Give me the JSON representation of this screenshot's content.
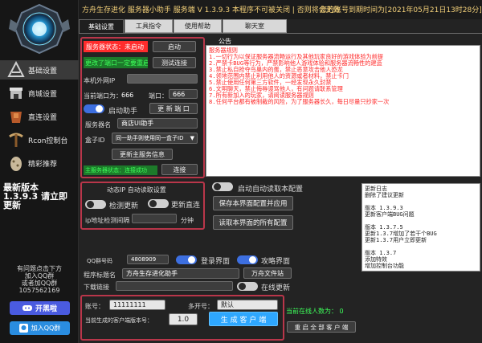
{
  "header": {
    "title": "方舟生存进化  服务器小助手  服务端 V 1.3.9.3 本程序不可被关闭 | 否则将会无效",
    "account": "您的账号到期时间为[2021年05月21日13时28分]"
  },
  "sidebar": {
    "items": [
      {
        "label": "基础设置",
        "icon": "ark-logo-icon"
      },
      {
        "label": "商城设置",
        "icon": "shop-icon"
      },
      {
        "label": "直连设置",
        "icon": "armor-icon"
      },
      {
        "label": "Rcon控制台",
        "icon": "pickaxe-icon"
      },
      {
        "label": "精彩推荐",
        "icon": "dino-egg-icon"
      }
    ],
    "promo": "最新版本\n1.3.9.3 请立即\n更新",
    "contact": "有问题点击下方\n加入QQ群\n或者加QQ群\n1057562169",
    "dark_btn": "开黑啦",
    "qq_btn": "加入QQ群"
  },
  "tabs": [
    "基础设置",
    "工具指令",
    "使用帮助",
    "聊天室"
  ],
  "left_panel": {
    "status_label": "服务器状态：未启动",
    "start_btn": "启动",
    "port_warning": "更改了端口一定要重启",
    "test_btn": "测试连接",
    "ip_label": "本机外网IP",
    "ip_value": "",
    "port_label": "当前端口为：",
    "port_value": "666",
    "port2_label": "端口：",
    "port2_value": "666",
    "auto_start_label": "启动助手",
    "update_port_btn": "更 新 端 口",
    "server_name_label": "服务器名",
    "server_name_value": "商店UI助手",
    "box_id_label": "盒子ID",
    "box_id_value": "同一助手则使用同一盒子ID",
    "update_server_btn": "更新主服务信息",
    "main_status": "主服务器状态：连接成功",
    "connect_btn": "连接"
  },
  "announcement": {
    "title": "公告",
    "text": "服务器规则\n1.一切行为以保证服务器流畅运行及其他玩家良好的游戏体验为前提\n2.严禁卡BUG等行为，严禁影响他人游戏体验和服务器流畅性的建造\n3.禁止私自抢夺鸟巢内的蛋，禁止恶意攻击他人恐龙\n4.领地范围内禁止利用他人的资源或者材料，禁止卡门\n5.禁止使用任何第三方软件，一经发现永久封禁\n6.文明聊天，禁止侮辱谩骂他人，有问题请联系管理\n7.所有新加入的玩家，请阅读服务器规则\n8.任何平台都有被制裁的风险，为了服务器长久，每日尽量只抄家一次"
  },
  "auto_read": {
    "label": "启动自动读取本配置"
  },
  "dynamic_ip": {
    "title": "动态IP 自动读取设置",
    "detect_label": "检测更新",
    "direct_label": "更新直连",
    "interval_label": "ip地址检测间隔",
    "interval_value": "",
    "unit": "分钟"
  },
  "config_btns": {
    "save": "保存本界面配置并应用",
    "load": "读取本界面的所有配置"
  },
  "changelog": "更新日志\n删除了建议更新\n\n版本 1.3.9.3\n更新客户端BUG问题\n\n版本 1.3.7.5\n更新1.3.7增加了若干个BUG\n更新1.3.7用户立即更新\n\n版本 1.3.7\n添加特效\n增加控制台功能",
  "bottom": {
    "qq_label": "QQ群号码",
    "qq_value": "4808909",
    "login_label": "登录界面",
    "attack_label": "攻略界面",
    "program_label": "程序标题名",
    "program_value": "方舟生存进化助手",
    "file_btn": "万舟文件站",
    "download_label": "下载链接",
    "download_value": "",
    "online_update_label": "在线更新",
    "account_label": "账号：",
    "account_value": "11111111",
    "password_label": "多开号：",
    "password_value": "默认",
    "version_label": "当前生成的客户端版本号：",
    "version_value": "1.0",
    "generate_btn": "生 成 客 户 端",
    "online_count": "当前在线人数为： 0",
    "restart_btn": "重 启 全 部 客 户 端"
  },
  "colors": {
    "accent_red": "#ff2c2c",
    "accent_blue": "#3d6fe0",
    "header_gold": "#f5d27a",
    "panel_border": "#b9364a",
    "green_text": "#3dff5a",
    "generate_btn": "#2ea7ff"
  }
}
